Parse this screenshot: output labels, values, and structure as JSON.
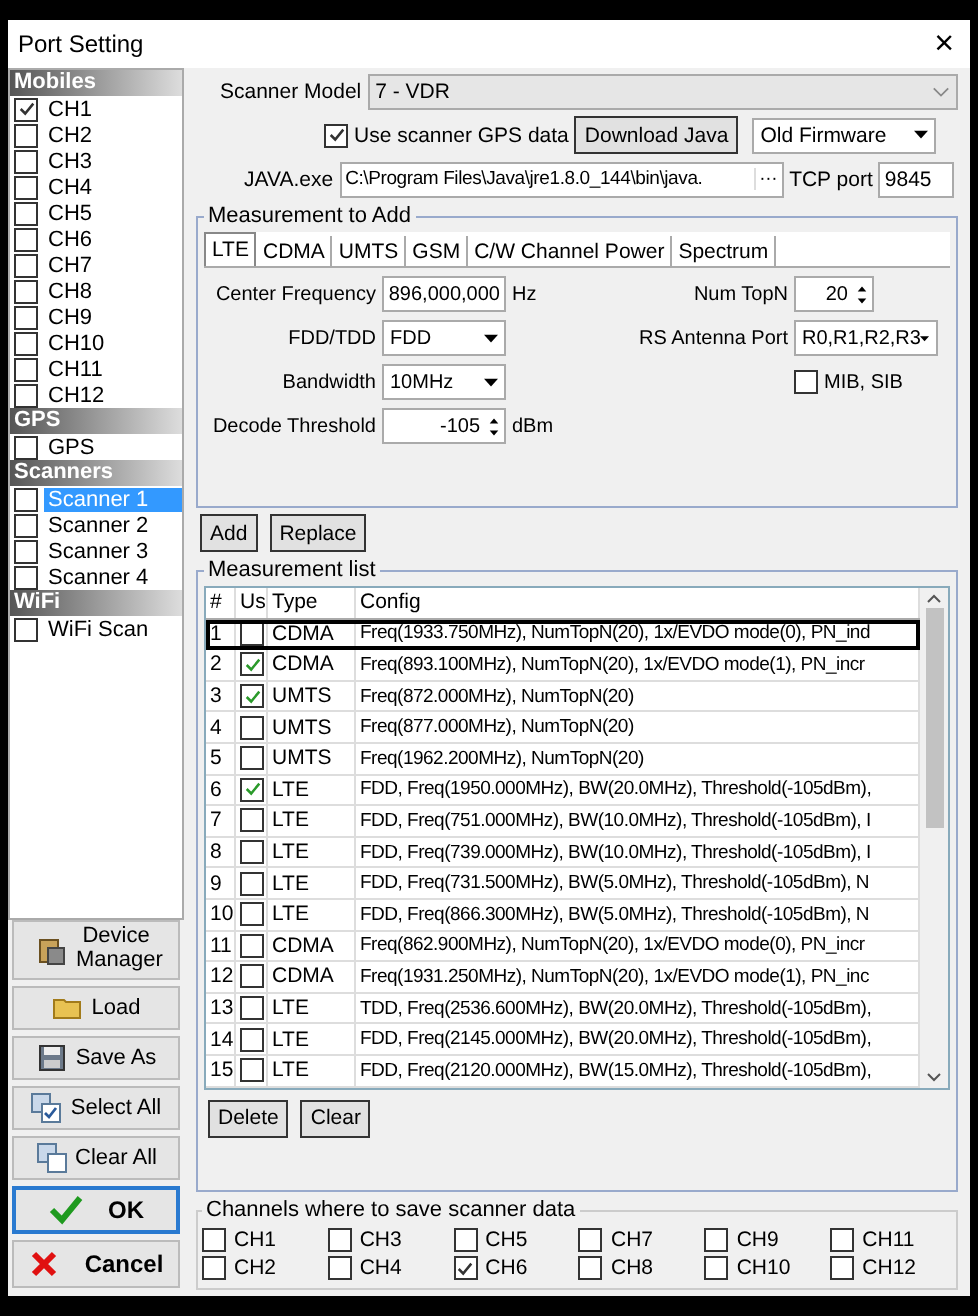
{
  "window": {
    "title": "Port Setting",
    "close": "×"
  },
  "sidebar": {
    "sections": [
      {
        "title": "Mobiles",
        "items": [
          {
            "label": "CH1",
            "checked": true,
            "selected": false
          },
          {
            "label": "CH2",
            "checked": false,
            "selected": false
          },
          {
            "label": "CH3",
            "checked": false,
            "selected": false
          },
          {
            "label": "CH4",
            "checked": false,
            "selected": false
          },
          {
            "label": "CH5",
            "checked": false,
            "selected": false
          },
          {
            "label": "CH6",
            "checked": false,
            "selected": false
          },
          {
            "label": "CH7",
            "checked": false,
            "selected": false
          },
          {
            "label": "CH8",
            "checked": false,
            "selected": false
          },
          {
            "label": "CH9",
            "checked": false,
            "selected": false
          },
          {
            "label": "CH10",
            "checked": false,
            "selected": false
          },
          {
            "label": "CH11",
            "checked": false,
            "selected": false
          },
          {
            "label": "CH12",
            "checked": false,
            "selected": false
          }
        ]
      },
      {
        "title": "GPS",
        "items": [
          {
            "label": "GPS",
            "checked": false,
            "selected": false
          }
        ]
      },
      {
        "title": "Scanners",
        "items": [
          {
            "label": "Scanner 1",
            "checked": false,
            "selected": true
          },
          {
            "label": "Scanner 2",
            "checked": false,
            "selected": false
          },
          {
            "label": "Scanner 3",
            "checked": false,
            "selected": false
          },
          {
            "label": "Scanner 4",
            "checked": false,
            "selected": false
          }
        ]
      },
      {
        "title": "WiFi",
        "items": [
          {
            "label": "WiFi Scan",
            "checked": false,
            "selected": false
          }
        ]
      }
    ]
  },
  "actions": [
    {
      "kind": "device",
      "label": "Device Manager"
    },
    {
      "kind": "load",
      "label": "Load"
    },
    {
      "kind": "save",
      "label": "Save As"
    },
    {
      "kind": "select",
      "label": "Select All"
    },
    {
      "kind": "clear",
      "label": "Clear All"
    },
    {
      "kind": "ok",
      "label": "OK"
    },
    {
      "kind": "cancel",
      "label": "Cancel"
    }
  ],
  "scanner_model": {
    "label": "Scanner Model",
    "value": "7 - VDR"
  },
  "use_gps": {
    "label": "Use scanner GPS data",
    "checked": true
  },
  "download_java": "Download Java",
  "firmware": "Old Firmware",
  "java_exe": {
    "label": "JAVA.exe",
    "value": "C:\\Program Files\\Java\\jre1.8.0_144\\bin\\java.",
    "browse": "···"
  },
  "tcp_port": {
    "label": "TCP port",
    "value": "9845"
  },
  "measurement_to_add": {
    "title": "Measurement to Add",
    "tabs": [
      {
        "label": "LTE",
        "selected": true
      },
      {
        "label": "CDMA",
        "selected": false
      },
      {
        "label": "UMTS",
        "selected": false
      },
      {
        "label": "GSM",
        "selected": false
      },
      {
        "label": "C/W Channel Power",
        "selected": false
      },
      {
        "label": "Spectrum",
        "selected": false
      }
    ],
    "left_fields": [
      {
        "kind": "number",
        "label": "Center Frequency",
        "value": "896,000,000",
        "unit": "Hz"
      },
      {
        "kind": "dropdown",
        "label": "FDD/TDD",
        "value": "FDD"
      },
      {
        "kind": "dropdown",
        "label": "Bandwidth",
        "value": "10MHz"
      },
      {
        "kind": "spinner",
        "label": "Decode Threshold",
        "value": "-105",
        "unit": "dBm"
      }
    ],
    "right_fields": [
      {
        "kind": "spinner",
        "label": "Num TopN",
        "value": "20"
      },
      {
        "kind": "dropdown",
        "label": "RS Antenna Port",
        "value": "R0,R1,R2,R3"
      },
      {
        "kind": "checkbox",
        "label": "MIB, SIB",
        "checked": false
      }
    ]
  },
  "add_buttons": [
    "Add",
    "Replace"
  ],
  "measurement_list": {
    "title": "Measurement list",
    "columns": [
      "#",
      "Us",
      "Type",
      "Config"
    ],
    "rows": [
      {
        "n": "1",
        "used": false,
        "focused": true,
        "type": "CDMA",
        "config": "Freq(1933.750MHz), NumTopN(20), 1x/EVDO mode(0), PN_ind"
      },
      {
        "n": "2",
        "used": true,
        "focused": false,
        "type": "CDMA",
        "config": "Freq(893.100MHz), NumTopN(20), 1x/EVDO mode(1), PN_incr"
      },
      {
        "n": "3",
        "used": true,
        "focused": false,
        "type": "UMTS",
        "config": "Freq(872.000MHz), NumTopN(20)"
      },
      {
        "n": "4",
        "used": false,
        "focused": false,
        "type": "UMTS",
        "config": "Freq(877.000MHz), NumTopN(20)"
      },
      {
        "n": "5",
        "used": false,
        "focused": false,
        "type": "UMTS",
        "config": "Freq(1962.200MHz), NumTopN(20)"
      },
      {
        "n": "6",
        "used": true,
        "focused": false,
        "type": "LTE",
        "config": "FDD, Freq(1950.000MHz), BW(20.0MHz), Threshold(-105dBm),"
      },
      {
        "n": "7",
        "used": false,
        "focused": false,
        "type": "LTE",
        "config": "FDD, Freq(751.000MHz), BW(10.0MHz), Threshold(-105dBm), I"
      },
      {
        "n": "8",
        "used": false,
        "focused": false,
        "type": "LTE",
        "config": "FDD, Freq(739.000MHz), BW(10.0MHz), Threshold(-105dBm), I"
      },
      {
        "n": "9",
        "used": false,
        "focused": false,
        "type": "LTE",
        "config": "FDD, Freq(731.500MHz), BW(5.0MHz), Threshold(-105dBm), N"
      },
      {
        "n": "10",
        "used": false,
        "focused": false,
        "type": "LTE",
        "config": "FDD, Freq(866.300MHz), BW(5.0MHz), Threshold(-105dBm), N"
      },
      {
        "n": "11",
        "used": false,
        "focused": false,
        "type": "CDMA",
        "config": "Freq(862.900MHz), NumTopN(20), 1x/EVDO mode(0), PN_incr"
      },
      {
        "n": "12",
        "used": false,
        "focused": false,
        "type": "CDMA",
        "config": "Freq(1931.250MHz), NumTopN(20), 1x/EVDO mode(1), PN_inc"
      },
      {
        "n": "13",
        "used": false,
        "focused": false,
        "type": "LTE",
        "config": "TDD, Freq(2536.600MHz), BW(20.0MHz), Threshold(-105dBm),"
      },
      {
        "n": "14",
        "used": false,
        "focused": false,
        "type": "LTE",
        "config": "FDD, Freq(2145.000MHz), BW(20.0MHz), Threshold(-105dBm),"
      },
      {
        "n": "15",
        "used": false,
        "focused": false,
        "type": "LTE",
        "config": "FDD, Freq(2120.000MHz), BW(15.0MHz), Threshold(-105dBm),"
      }
    ],
    "buttons": [
      "Delete",
      "Clear"
    ]
  },
  "save_channels": {
    "title": "Channels where to save scanner data",
    "items": [
      {
        "label": "CH1",
        "checked": false
      },
      {
        "label": "CH2",
        "checked": false
      },
      {
        "label": "CH3",
        "checked": false
      },
      {
        "label": "CH4",
        "checked": false
      },
      {
        "label": "CH5",
        "checked": false
      },
      {
        "label": "CH6",
        "checked": true
      },
      {
        "label": "CH7",
        "checked": false
      },
      {
        "label": "CH8",
        "checked": false
      },
      {
        "label": "CH9",
        "checked": false
      },
      {
        "label": "CH10",
        "checked": false
      },
      {
        "label": "CH11",
        "checked": false
      },
      {
        "label": "CH12",
        "checked": false
      }
    ]
  }
}
